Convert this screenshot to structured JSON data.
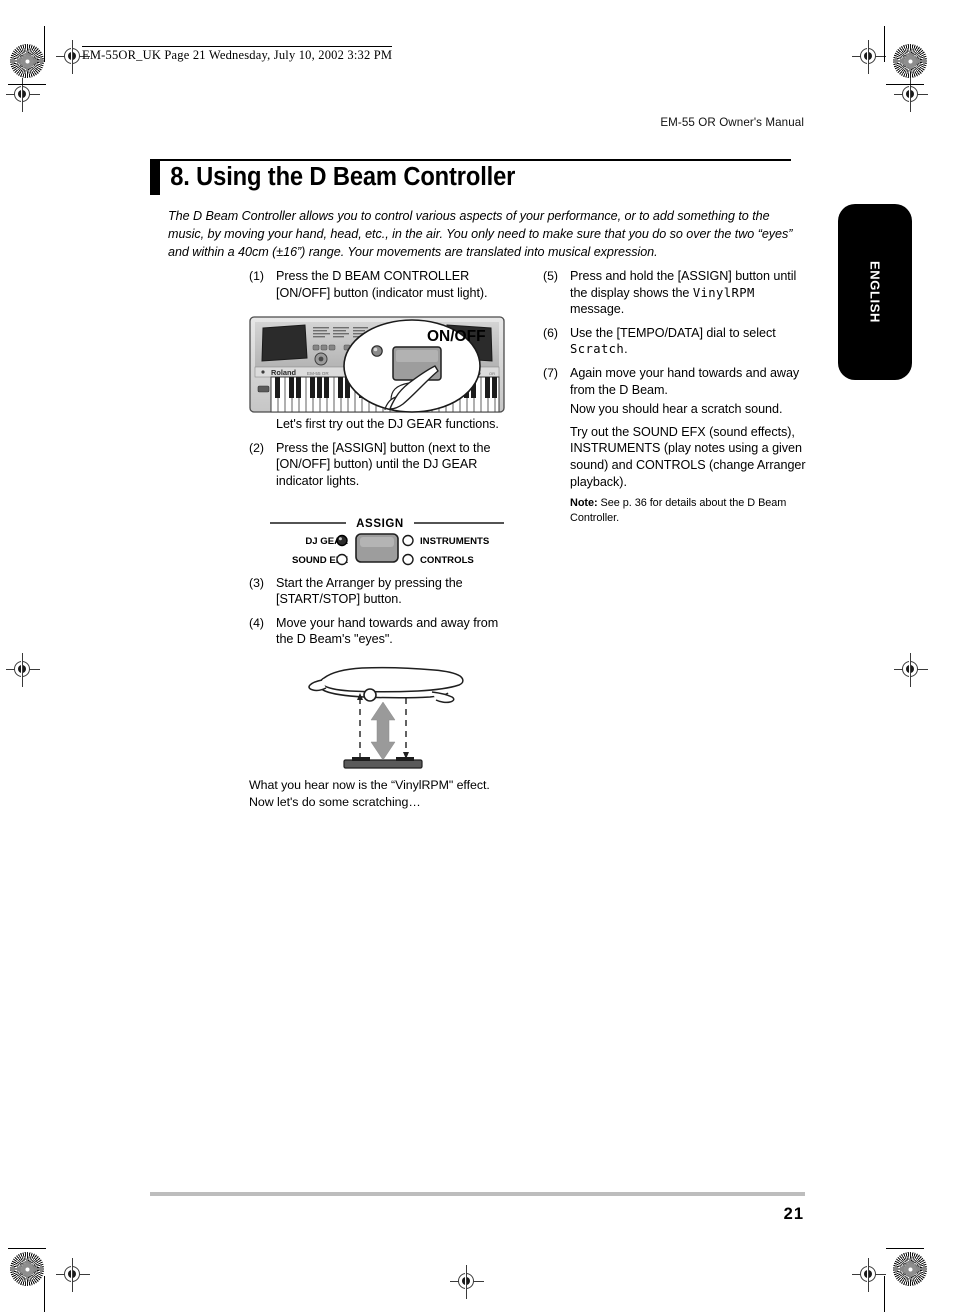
{
  "print_slug": "EM-55OR_UK  Page 21  Wednesday, July 10, 2002  3:32 PM",
  "running_head": "EM-55 OR Owner's Manual",
  "chapter": {
    "title": "8. Using the D Beam Controller"
  },
  "intro": "The D Beam Controller allows you to control various aspects of your performance, or to add something to the music, by moving your hand, head, etc., in the air. You only need to make sure that you do so over the two “eyes” and within a 40cm (±16”) range. Your movements are translated into musical expression.",
  "left_column": {
    "step1": {
      "num": "(1)",
      "text": "Press the D BEAM CONTROLLER [ON/OFF] button (indicator must light)."
    },
    "figure_keyboard": {
      "callout_label": "ON/OFF",
      "brand_label": "Roland",
      "model_label": "EM-55 OR"
    },
    "caption_dj_gear": "Let's first try out the DJ GEAR functions.",
    "step2": {
      "num": "(2)",
      "text": "Press the [ASSIGN] button (next to the [ON/OFF] button) until the DJ GEAR indicator lights."
    },
    "figure_assign": {
      "title": "ASSIGN",
      "labels": {
        "dj_gear": "DJ GEAR",
        "sound_efx": "SOUND EFX",
        "instruments": "INSTRUMENTS",
        "controls": "CONTROLS"
      },
      "led_states": {
        "dj_gear": "on",
        "sound_efx": "off",
        "instruments": "off",
        "controls": "off"
      }
    },
    "step3": {
      "num": "(3)",
      "text": "Start the Arranger by pressing the [START/STOP] button."
    },
    "step4": {
      "num": "(4)",
      "text": "Move your hand towards and away from the D Beam's \"eyes\"."
    },
    "caption_vinylrpm": "What you hear now is the “VinylRPM\" effect. Now let's do some scratching…"
  },
  "right_column": {
    "step5": {
      "num": "(5)",
      "text_before": "Press and hold the [ASSIGN] button until the display shows the ",
      "lcd": "VinylRPM",
      "text_after": " message."
    },
    "step6": {
      "num": "(6)",
      "text_before": "Use the [TEMPO/DATA] dial to select ",
      "lcd": "Scratch",
      "text_after": "."
    },
    "step7": {
      "num": "(7)",
      "text": "Again move your hand towards and away from the D Beam.",
      "sub1": "Now you should hear a scratch sound.",
      "sub2": "Try out the SOUND EFX (sound effects), INSTRUMENTS (play notes using a given sound) and CONTROLS (change Arranger playback).",
      "note_label": "Note:",
      "note_text": " See p. 36 for details about the D Beam Controller."
    }
  },
  "side_tab": {
    "label": "ENGLISH"
  },
  "footer": {
    "page_number": "21"
  },
  "colors": {
    "rule": "#bdbdbd",
    "ink": "#000000",
    "panel_gray": "#9a9a9a"
  }
}
